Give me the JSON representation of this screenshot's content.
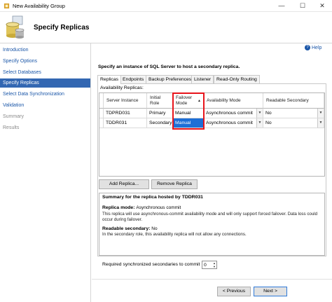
{
  "window": {
    "title": "New Availability Group",
    "minimize": "—",
    "maximize": "☐",
    "close": "✕"
  },
  "header": {
    "title": "Specify Replicas"
  },
  "sidebar": {
    "items": [
      {
        "label": "Introduction",
        "state": "link"
      },
      {
        "label": "Specify Options",
        "state": "link"
      },
      {
        "label": "Select Databases",
        "state": "link"
      },
      {
        "label": "Specify Replicas",
        "state": "selected"
      },
      {
        "label": "Select Data Synchronization",
        "state": "link"
      },
      {
        "label": "Validation",
        "state": "link"
      },
      {
        "label": "Summary",
        "state": "disabled"
      },
      {
        "label": "Results",
        "state": "disabled"
      }
    ]
  },
  "help": {
    "label": "Help"
  },
  "main": {
    "instruction": "Specify an instance of SQL Server to host a secondary replica.",
    "tabs": [
      {
        "label": "Replicas",
        "active": true
      },
      {
        "label": "Endpoints",
        "active": false
      },
      {
        "label": "Backup Preferences",
        "active": false
      },
      {
        "label": "Listener",
        "active": false
      },
      {
        "label": "Read-Only Routing",
        "active": false
      }
    ],
    "panel_label": "Availability Replicas:",
    "grid": {
      "headers": {
        "server": "Server Instance",
        "role_1": "Initial",
        "role_2": "Role",
        "failover_1": "Failover",
        "failover_2": "Mode",
        "availability": "Availability Mode",
        "readable": "Readable Secondary"
      },
      "sort_arrow": "▲",
      "dropdown_arrow": "▼",
      "rows": [
        {
          "server": "TDPRD031",
          "role": "Primary",
          "failover": "Manual",
          "availability": "Asynchronous commit",
          "readable": "No"
        },
        {
          "server": "TDDR031",
          "role": "Secondary",
          "failover": "Manual",
          "availability": "Asynchronous commit",
          "readable": "No"
        }
      ]
    },
    "buttons": {
      "add_replica": "Add Replica...",
      "remove_replica": "Remove Replica"
    },
    "summary": {
      "title": "Summary for the replica hosted by TDDR031",
      "replica_mode_label": "Replica mode:",
      "replica_mode_value": "Asynchronous commit",
      "replica_mode_line1": "This replica will use asynchronous-commit availability mode and will only support forced failover. Data loss could",
      "replica_mode_line2": "occur during failover.",
      "readable_label": "Readable secondary:",
      "readable_value": "No",
      "readable_text": "In the secondary role, this availability replica will not allow any connections."
    },
    "required_label": "Required synchronized secondaries to commit",
    "required_value": "0",
    "spin_up": "▲",
    "spin_down": "▼"
  },
  "footer": {
    "previous": "< Previous",
    "next": "Next >"
  },
  "colors": {
    "accent": "#3367b2",
    "highlight": "#e8141b",
    "link": "#1a56a8"
  }
}
